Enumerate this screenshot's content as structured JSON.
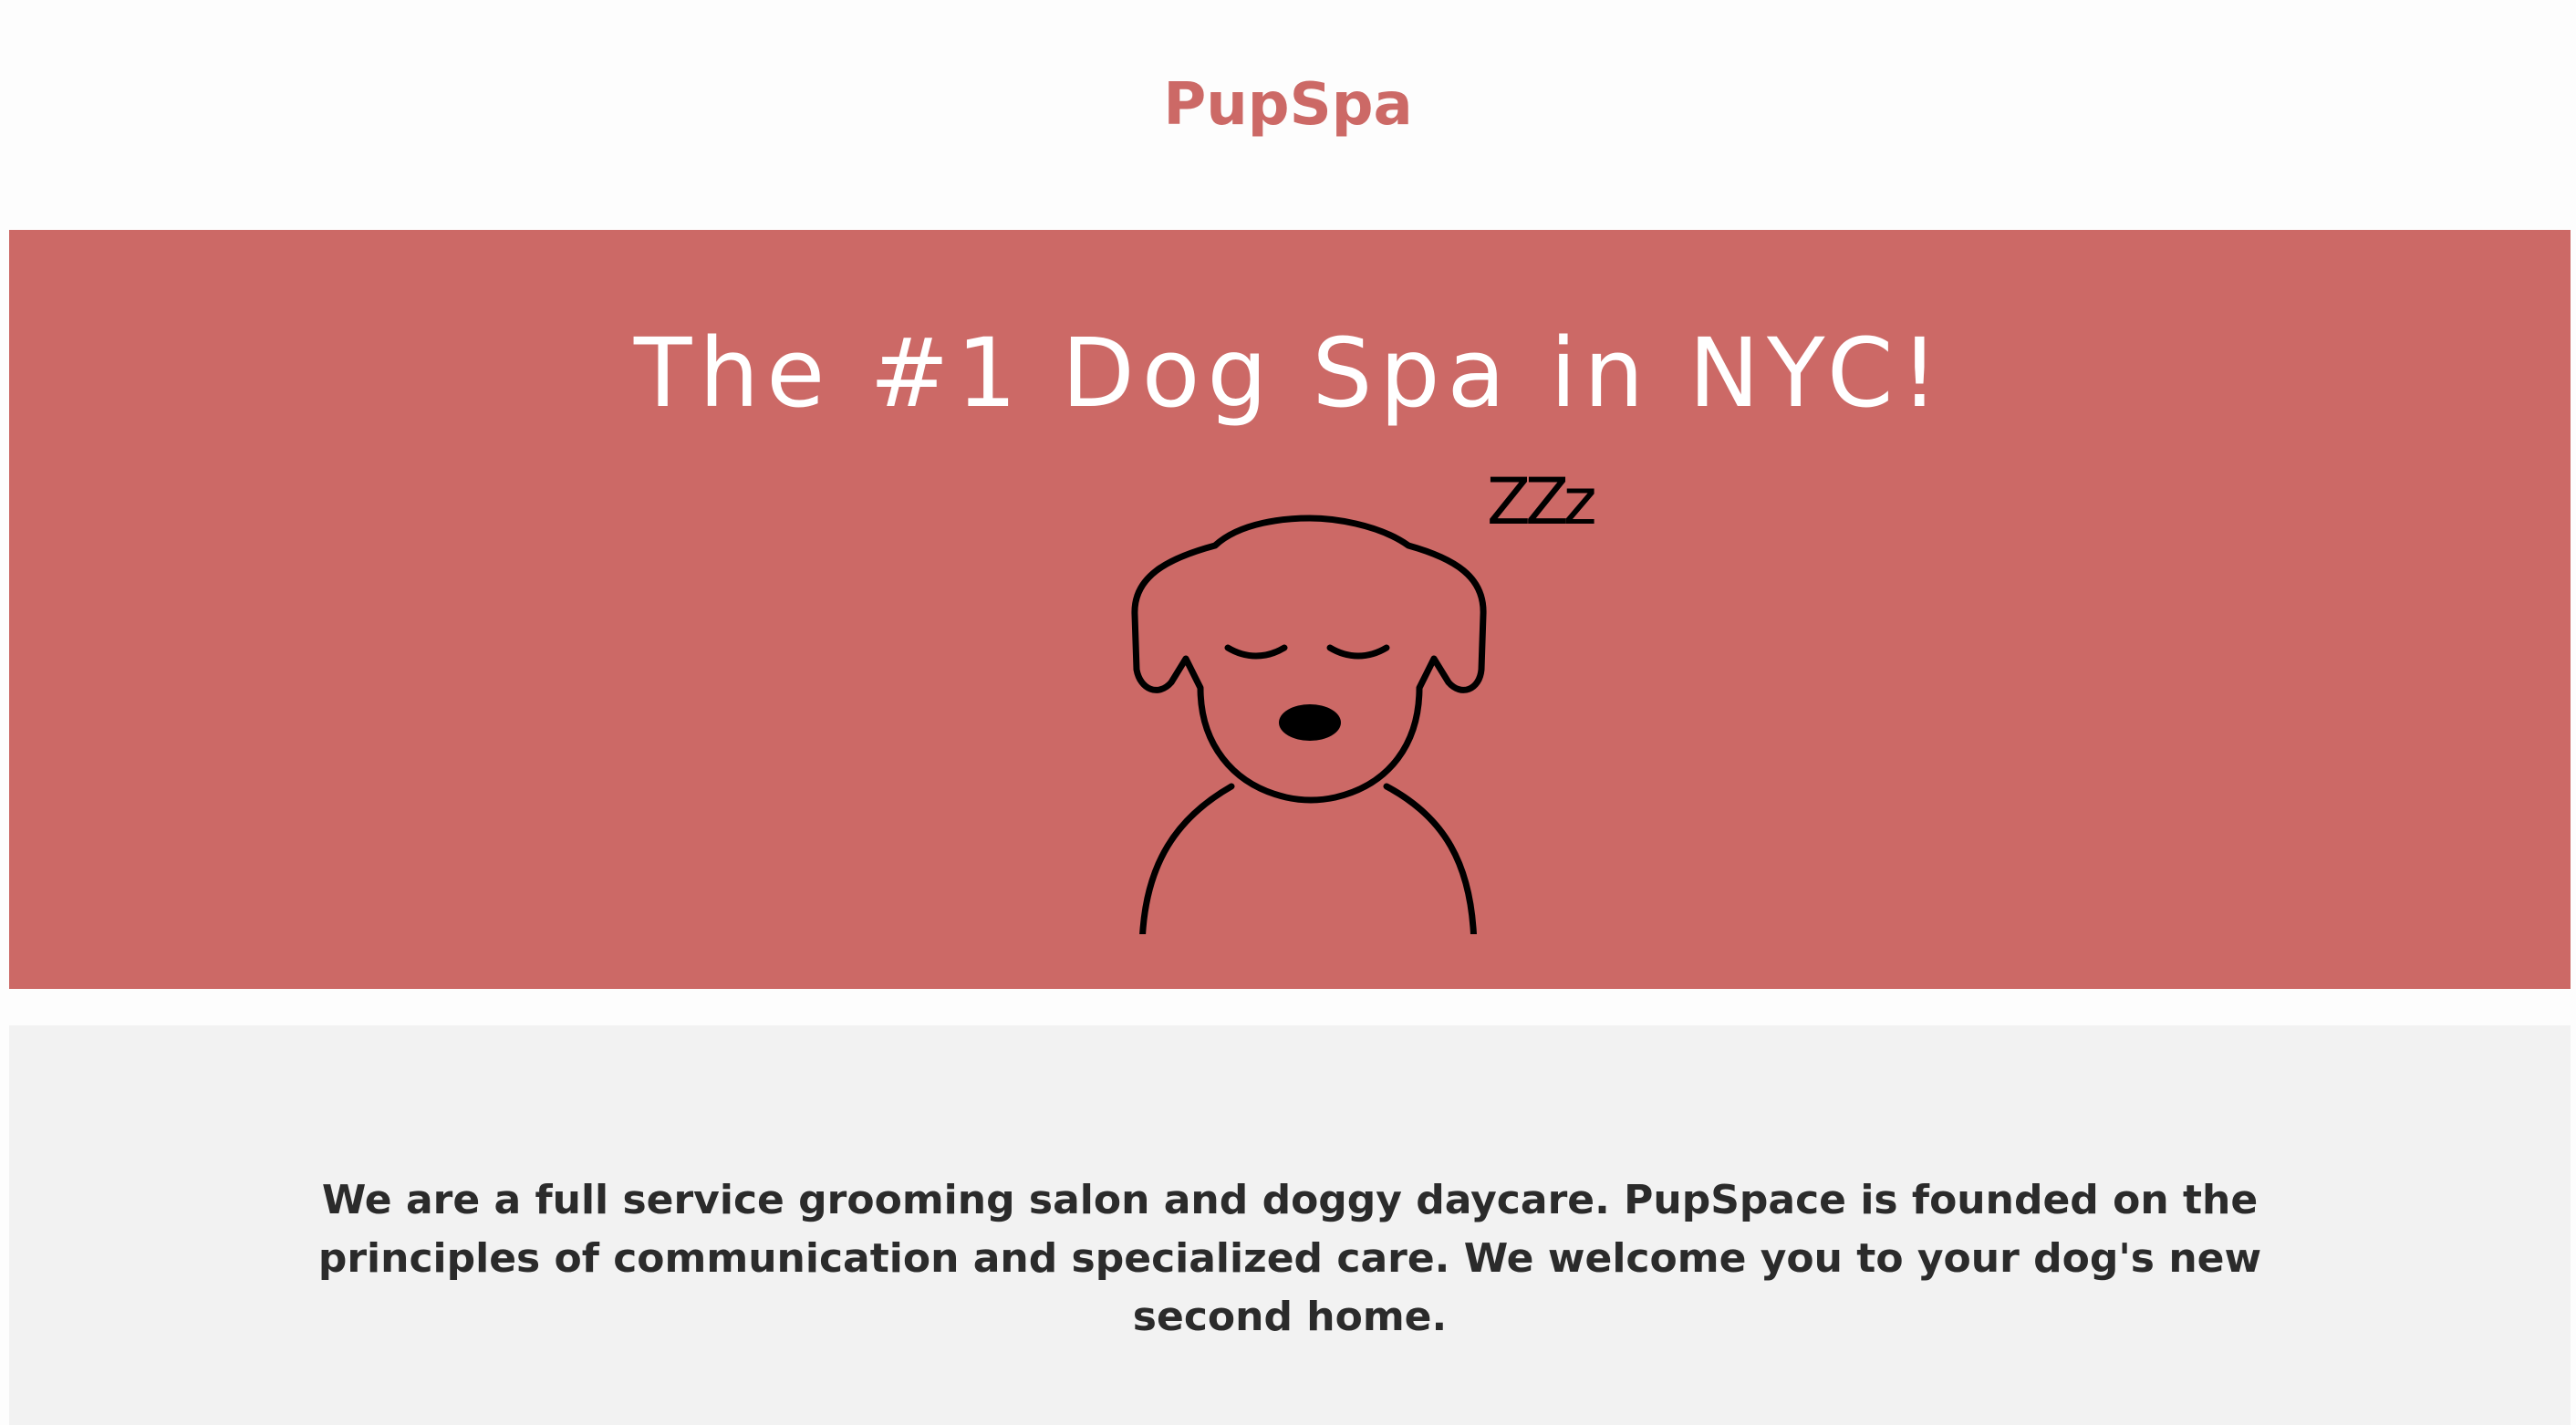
{
  "header": {
    "brand": "PupSpa"
  },
  "hero": {
    "title": "The #1 Dog Spa in NYC!",
    "illustration_icon": "sleeping-dog-icon",
    "sleep_text": "ZZz"
  },
  "about": {
    "text": "We are a full service grooming salon and doggy daycare. PupSpace is founded on the principles of communication and specialized care. We welcome you to your dog's new second home."
  },
  "colors": {
    "brand": "#cc6966",
    "hero_background": "#cc6966",
    "about_background": "#f2f2f2",
    "body_text": "#2b2b2b"
  }
}
